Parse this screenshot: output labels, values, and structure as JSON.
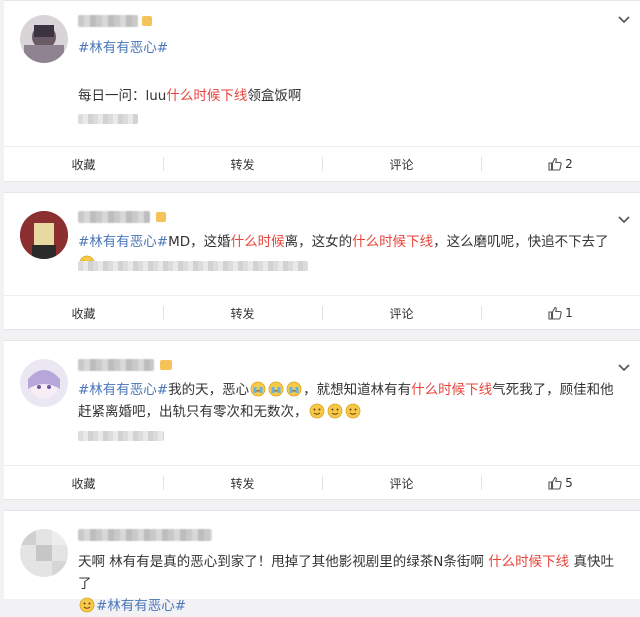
{
  "posts": [
    {
      "hashtag": "#林有有恶心#",
      "content": {
        "t1": "每日一问：luu",
        "h1": "什么时候下线",
        "t2": "领盒饭啊"
      },
      "actions": {
        "collect": "收藏",
        "repost": "转发",
        "comment": "评论",
        "likes": "2"
      }
    },
    {
      "content": {
        "hashtag": "#林有有恶心#",
        "t1": "MD，这婚",
        "h1": "什么时候",
        "t2": "离，这女的",
        "h2": "什么时候下线",
        "t3": "，这么磨叽呢，快追不下去了"
      },
      "actions": {
        "collect": "收藏",
        "repost": "转发",
        "comment": "评论",
        "likes": "1"
      }
    },
    {
      "content": {
        "hashtag": "#林有有恶心#",
        "t1": "我的天，恶心",
        "t2": "，就想知道林有有",
        "h1": "什么时候下线",
        "t3": "气死我了，顾佳和他赶紧离婚吧，出轨只有零次和无数次，"
      },
      "actions": {
        "collect": "收藏",
        "repost": "转发",
        "comment": "评论",
        "likes": "5"
      }
    },
    {
      "content": {
        "t1": "天啊 林有有是真的恶心到家了！甩掉了其他影视剧里的绿茶N条街啊 ",
        "h1": "什么时候下线",
        "t2": " 真快吐了",
        "hashtag": "#林有有恶心#"
      }
    }
  ],
  "colors": {
    "hashtag": "#4a76b8",
    "highlight": "#e8443b",
    "vip": "#f5c35a"
  },
  "icons": [
    "chevron-down-icon",
    "thumbs-up-icon",
    "crying-emoji-icon",
    "smile-emoji-icon",
    "laughing-tears-emoji-icon"
  ]
}
